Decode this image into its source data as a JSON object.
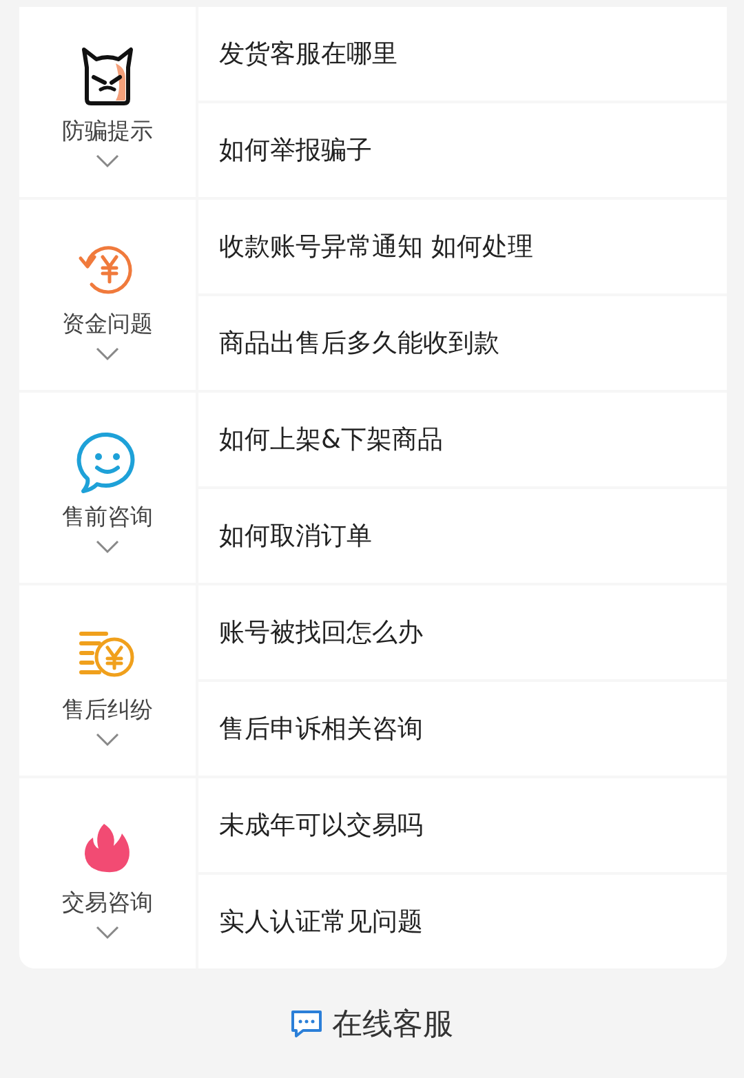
{
  "categories": [
    {
      "label": "防骗提示",
      "questions": [
        "发货客服在哪里",
        "如何举报骗子"
      ]
    },
    {
      "label": "资金问题",
      "questions": [
        "收款账号异常通知 如何处理",
        "商品出售后多久能收到款"
      ]
    },
    {
      "label": "售前咨询",
      "questions": [
        "如何上架&下架商品",
        "如何取消订单"
      ]
    },
    {
      "label": "售后纠纷",
      "questions": [
        "账号被找回怎么办",
        "售后申诉相关咨询"
      ]
    },
    {
      "label": "交易咨询",
      "questions": [
        "未成年可以交易吗",
        "实人认证常见问题"
      ]
    }
  ],
  "footer_button": {
    "label": "在线客服"
  }
}
